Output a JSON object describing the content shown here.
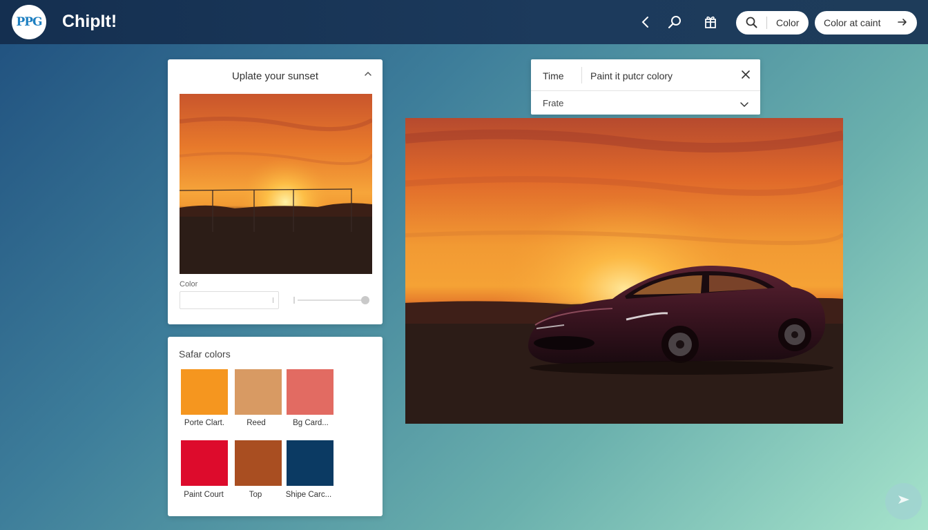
{
  "header": {
    "logo_text": "PPG",
    "app_title": "ChipIt!",
    "icons": [
      "chevron-left-icon",
      "search-icon",
      "gift-icon"
    ],
    "search_pill": {
      "icon": "search-icon",
      "label": "Color"
    },
    "cta_pill": {
      "label": "Color at caint",
      "icon": "arrow-right-icon"
    }
  },
  "sunset_card": {
    "title": "Uplate your sunset",
    "collapse_icon": "chevron-up-icon",
    "photo": "sunset-field-photo",
    "color_label": "Color",
    "color_input_value": "",
    "slider_value": 1.0
  },
  "colors_card": {
    "title": "Safar colors",
    "swatches": [
      {
        "label": "Porte Clart.",
        "color": "#f5961f"
      },
      {
        "label": "Reed",
        "color": "#d89a63"
      },
      {
        "label": "Bg Card...",
        "color": "#e26b62"
      },
      {
        "label": "Paint Court",
        "color": "#dd0b2c"
      },
      {
        "label": "Top",
        "color": "#a94e21"
      },
      {
        "label": "Shipe Carc...",
        "color": "#0b3a63"
      }
    ]
  },
  "time_card": {
    "time_label": "Time",
    "time_value": "Paint it putcr colory",
    "close_icon": "close-icon",
    "frate_label": "Frate",
    "frate_icon": "chevron-down-icon"
  },
  "car_photo": "sports-car-sunset-photo",
  "fab_icon": "send-icon",
  "colors": {
    "header_bg": "#16304f",
    "accent_blue": "#1d7fc1"
  }
}
